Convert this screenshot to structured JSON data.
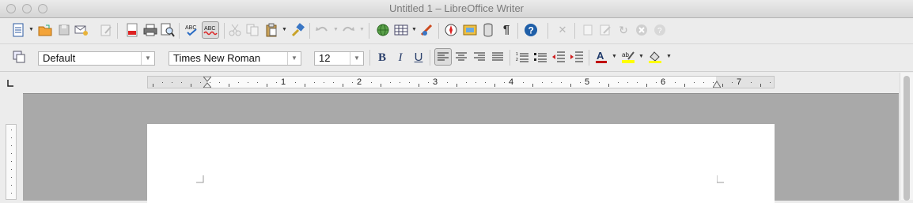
{
  "window": {
    "title": "Untitled 1 – LibreOffice Writer"
  },
  "formatting": {
    "paragraph_style": "Default",
    "font_name": "Times New Roman",
    "font_size": "12"
  },
  "toolbar_standard": [
    "new-document",
    "open",
    "save",
    "email-document",
    "edit-file",
    "export-pdf",
    "print",
    "print-preview",
    "spellcheck",
    "auto-spellcheck",
    "cut",
    "copy",
    "paste",
    "clone-formatting",
    "undo",
    "redo",
    "hyperlink",
    "table",
    "show-draw-functions",
    "navigator",
    "gallery",
    "data-sources",
    "formatting-marks",
    "help"
  ],
  "toolbar_formatting_buttons": {
    "bold": "B",
    "italic": "I",
    "underline": "U"
  },
  "ruler": {
    "labels": [
      "1",
      "2",
      "3",
      "4",
      "5",
      "6",
      "7"
    ],
    "unit": "inches"
  },
  "colors": {
    "font_color": "#c00000",
    "highlight_color": "#ffff00",
    "help_blue": "#1f5fa8"
  }
}
